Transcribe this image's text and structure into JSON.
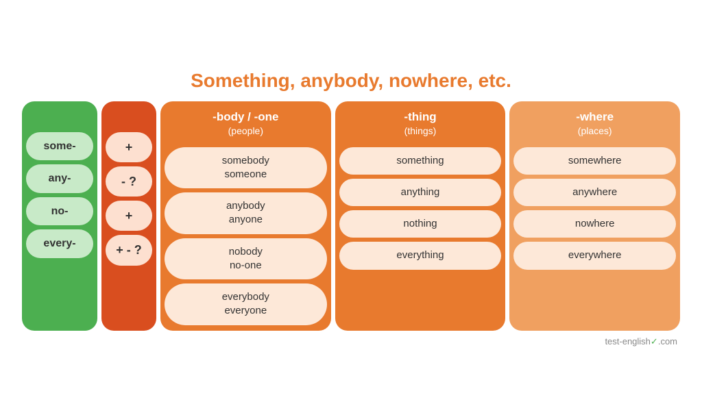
{
  "title": "Something, anybody, nowhere, etc.",
  "columns": {
    "prefix": {
      "header": "",
      "items": [
        "some-",
        "any-",
        "no-",
        "every-"
      ]
    },
    "sign": {
      "header": "",
      "items": [
        "+",
        "- ?",
        "+",
        "+ - ?"
      ]
    },
    "body": {
      "header": "-body / -one",
      "subheader": "(people)",
      "items": [
        "somebody\nsomeone",
        "anybody\nanyone",
        "nobody\nno-one",
        "everybody\neveryone"
      ]
    },
    "thing": {
      "header": "-thing",
      "subheader": "(things)",
      "items": [
        "something",
        "anything",
        "nothing",
        "everything"
      ]
    },
    "where": {
      "header": "-where",
      "subheader": "(places)",
      "items": [
        "somewhere",
        "anywhere",
        "nowhere",
        "everywhere"
      ]
    }
  },
  "footer": {
    "brand": "test-english",
    "tld": ".com"
  }
}
